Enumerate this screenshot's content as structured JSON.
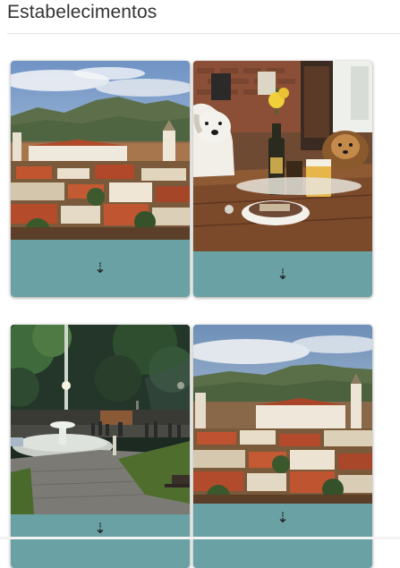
{
  "page": {
    "title": "Estabelecimentos"
  },
  "colors": {
    "footer_teal": "#6aa1a4",
    "title_text": "#333333",
    "divider": "#e4e4e4"
  },
  "cards": [
    {
      "image": "colonial-town-hillside-photo",
      "footer_icon": "down-arrow-icon",
      "footer_glyph": "⇣"
    },
    {
      "image": "dogs-at-bar-table-photo",
      "footer_icon": "down-arrow-icon",
      "footer_glyph": "⇣"
    },
    {
      "image": "night-plaza-fountain-photo",
      "footer_icon": "down-arrow-icon",
      "footer_glyph": "⇣"
    },
    {
      "image": "colonial-town-hillside-photo",
      "footer_icon": "down-arrow-icon",
      "footer_glyph": "⇣"
    }
  ]
}
